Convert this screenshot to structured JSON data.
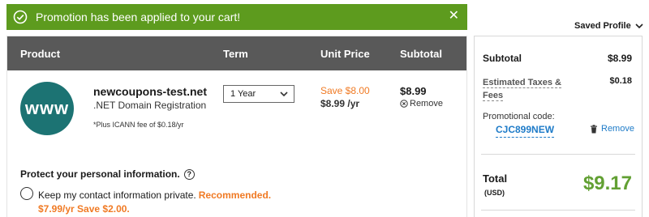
{
  "banner": {
    "message": "Promotion has been applied to your cart!",
    "close_glyph": "✕",
    "color": "#5d9b1e"
  },
  "cart": {
    "headers": [
      "Product",
      "Term",
      "Unit Price",
      "Subtotal"
    ],
    "item": {
      "avatar_text": "www",
      "domain": "newcoupons-test.net",
      "type": ".NET Domain Registration",
      "fee_note": "*Plus ICANN fee of $0.18/yr",
      "term": "1 Year",
      "save": "Save $8.00",
      "unit_price": "$8.99 /yr",
      "subtotal": "$8.99",
      "remove_label": "Remove"
    },
    "privacy": {
      "title": "Protect your personal information.",
      "help_glyph": "?",
      "option_text": "Keep my contact information private.",
      "recommended": "Recommended.",
      "price": "$7.99/yr Save $2.00."
    }
  },
  "summary": {
    "saved_profile": "Saved Profile",
    "subtotal_label": "Subtotal",
    "subtotal_value": "$8.99",
    "taxes_label": "Estimated Taxes & Fees",
    "taxes_value": "$0.18",
    "promo_label": "Promotional code:",
    "promo_code": "CJC899NEW",
    "promo_remove": "Remove",
    "total_label": "Total",
    "currency": "(USD)",
    "total_value": "$9.17"
  },
  "colors": {
    "header_bg": "#595959",
    "accent_orange": "#f07a24",
    "link_blue": "#1e7bc8",
    "total_green": "#62a033",
    "avatar_teal": "#1c7373"
  },
  "icons": [
    "check-circle-icon",
    "close-icon",
    "chevron-down-icon",
    "remove-circle-icon",
    "help-icon",
    "trash-icon"
  ]
}
